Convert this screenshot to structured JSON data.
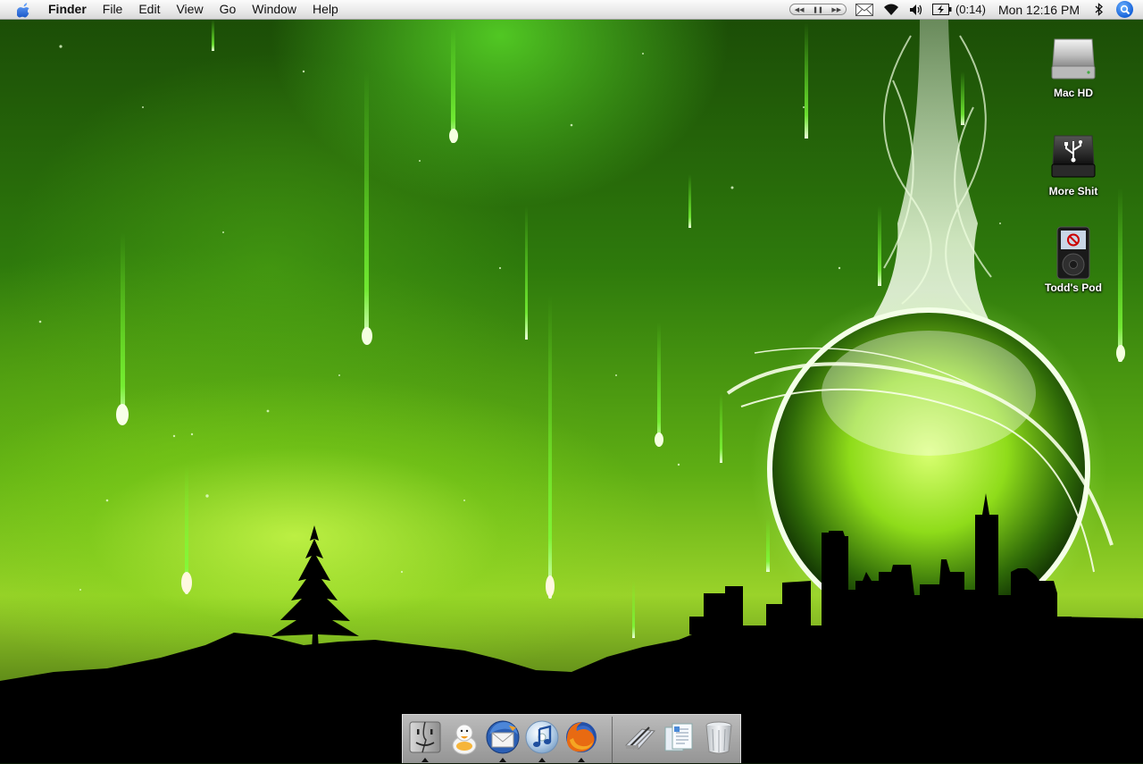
{
  "menubar": {
    "app_name": "Finder",
    "menus": [
      "File",
      "Edit",
      "View",
      "Go",
      "Window",
      "Help"
    ],
    "battery_time": "(0:14)",
    "clock": "Mon 12:16 PM"
  },
  "desktop": {
    "icons": [
      {
        "label": "Mac HD",
        "icon": "hard-drive-icon"
      },
      {
        "label": "More Shit",
        "icon": "usb-drive-icon"
      },
      {
        "label": "Todd's Pod",
        "icon": "ipod-icon"
      }
    ]
  },
  "dock": {
    "apps": [
      {
        "name": "finder",
        "icon": "finder-icon",
        "running": true
      },
      {
        "name": "adium",
        "icon": "adium-duck-icon",
        "running": false
      },
      {
        "name": "thunderbird",
        "icon": "thunderbird-icon",
        "running": true
      },
      {
        "name": "itunes",
        "icon": "itunes-icon",
        "running": true
      },
      {
        "name": "firefox",
        "icon": "firefox-icon",
        "running": true
      }
    ],
    "docs": [
      {
        "name": "applications",
        "icon": "applications-stack-icon"
      },
      {
        "name": "documents",
        "icon": "documents-stack-icon"
      },
      {
        "name": "trash",
        "icon": "trash-icon"
      }
    ]
  },
  "colors": {
    "wallpaper_primary": "#5fae14",
    "wallpaper_glow": "#c8ff50",
    "silhouette": "#000000"
  }
}
